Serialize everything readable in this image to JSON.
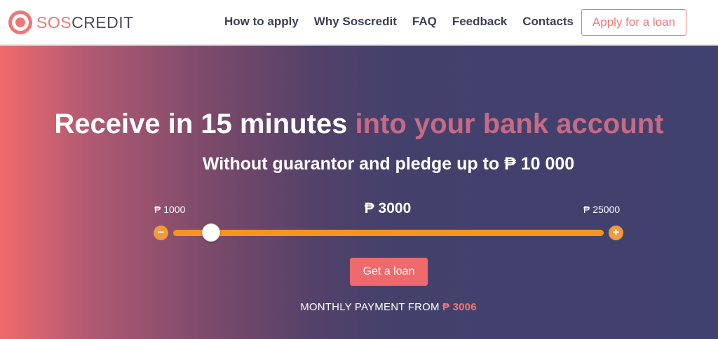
{
  "brand": {
    "name_accent": "SOS",
    "name_rest": "CREDIT",
    "colors": {
      "accent": "#ef7774",
      "orange": "#f7941d",
      "navy": "#41416f"
    }
  },
  "nav": {
    "items": [
      {
        "label": "How to apply"
      },
      {
        "label": "Why Soscredit"
      },
      {
        "label": "FAQ"
      },
      {
        "label": "Feedback"
      },
      {
        "label": "Contacts"
      }
    ],
    "apply_label": "Apply for a loan"
  },
  "hero": {
    "headline_main": "Receive in 15 minutes",
    "headline_accent": "into your bank account",
    "subline": "Without guarantor and pledge up to ₱ 10 000"
  },
  "calculator": {
    "min_label": "₱ 1000",
    "max_label": "₱ 25000",
    "amount_label": "₱ 3000",
    "min_value": 1000,
    "max_value": 25000,
    "current_value": 3000,
    "minus_icon": "minus-icon",
    "plus_icon": "plus-icon",
    "minus_glyph": "−",
    "plus_glyph": "+",
    "cta_label": "Get a loan",
    "monthly_prefix": "MONTHLY PAYMENT FROM",
    "monthly_amount": "₱ 3006"
  }
}
